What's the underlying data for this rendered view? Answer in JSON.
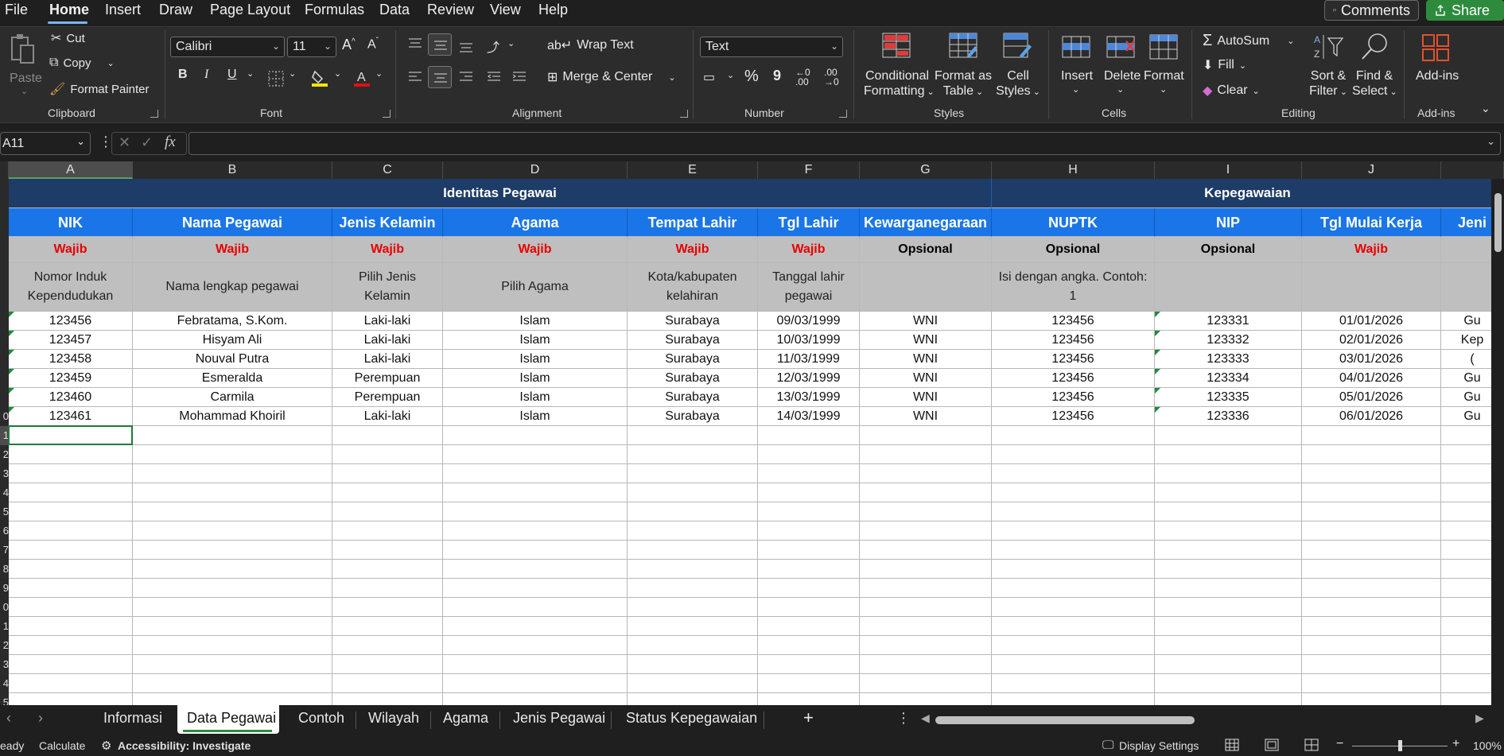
{
  "menu": {
    "tabs": [
      "File",
      "Home",
      "Insert",
      "Draw",
      "Page Layout",
      "Formulas",
      "Data",
      "Review",
      "View",
      "Help"
    ],
    "comments": "Comments",
    "share": "Share"
  },
  "ribbon": {
    "clipboard": {
      "paste": "Paste",
      "cut": "Cut",
      "copy": "Copy",
      "format_painter": "Format Painter",
      "label": "Clipboard"
    },
    "font": {
      "name": "Calibri",
      "size": "11",
      "bold": "B",
      "italic": "I",
      "underline": "U",
      "label": "Font"
    },
    "alignment": {
      "wrap_text": "Wrap Text",
      "merge_center": "Merge & Center",
      "label": "Alignment"
    },
    "number": {
      "format": "Text",
      "percent": "%",
      "comma": "9",
      "label": "Number"
    },
    "styles": {
      "conditional": [
        "Conditional",
        "Formatting"
      ],
      "format_table": [
        "Format as",
        "Table"
      ],
      "cell_styles": [
        "Cell",
        "Styles"
      ],
      "label": "Styles"
    },
    "cells": {
      "insert": "Insert",
      "delete": "Delete",
      "format": "Format",
      "label": "Cells"
    },
    "editing": {
      "autosum": "AutoSum",
      "fill": "Fill",
      "clear": "Clear",
      "sort_filter": [
        "Sort &",
        "Filter"
      ],
      "find_select": [
        "Find &",
        "Select"
      ],
      "label": "Editing"
    },
    "addins": {
      "addins": "Add-ins",
      "label": "Add-ins"
    }
  },
  "formula_bar": {
    "name_box": "A11",
    "fx": "fx",
    "content": ""
  },
  "grid": {
    "columns": [
      "A",
      "B",
      "C",
      "D",
      "E",
      "F",
      "G",
      "H",
      "I",
      "J",
      ""
    ],
    "selected_column": "A",
    "section_headers": [
      "Identitas Pegawai",
      "Kepegawaian"
    ],
    "field_headers": [
      "NIK",
      "Nama Pegawai",
      "Jenis Kelamin",
      "Agama",
      "Tempat Lahir",
      "Tgl Lahir",
      "Kewarganegaraan",
      "NUPTK",
      "NIP",
      "Tgl Mulai Kerja",
      "Jeni"
    ],
    "requirement": [
      "Wajib",
      "Wajib",
      "Wajib",
      "Wajib",
      "Wajib",
      "Wajib",
      "Opsional",
      "Opsional",
      "Opsional",
      "Wajib",
      ""
    ],
    "descriptions": [
      "Nomor Induk Kependudukan",
      "Nama lengkap pegawai",
      "Pilih Jenis Kelamin",
      "Pilih Agama",
      "Kota/kabupaten kelahiran",
      "Tanggal lahir pegawai",
      "",
      "Isi dengan angka. Contoh: 1",
      "",
      "",
      ""
    ],
    "rows": [
      [
        "123456",
        "Febratama, S.Kom.",
        "Laki-laki",
        "Islam",
        "Surabaya",
        "09/03/1999",
        "WNI",
        "123456",
        "123331",
        "01/01/2026",
        "Gu"
      ],
      [
        "123457",
        "Hisyam Ali",
        "Laki-laki",
        "Islam",
        "Surabaya",
        "10/03/1999",
        "WNI",
        "123456",
        "123332",
        "02/01/2026",
        "Kep"
      ],
      [
        "123458",
        "Nouval Putra",
        "Laki-laki",
        "Islam",
        "Surabaya",
        "11/03/1999",
        "WNI",
        "123456",
        "123333",
        "03/01/2026",
        "("
      ],
      [
        "123459",
        "Esmeralda",
        "Perempuan",
        "Islam",
        "Surabaya",
        "12/03/1999",
        "WNI",
        "123456",
        "123334",
        "04/01/2026",
        "Gu"
      ],
      [
        "123460",
        "Carmila",
        "Perempuan",
        "Islam",
        "Surabaya",
        "13/03/1999",
        "WNI",
        "123456",
        "123335",
        "05/01/2026",
        "Gu"
      ],
      [
        "123461",
        "Mohammad Khoiril",
        "Laki-laki",
        "Islam",
        "Surabaya",
        "14/03/1999",
        "WNI",
        "123456",
        "123336",
        "06/01/2026",
        "Gu"
      ]
    ],
    "row_numbers": [
      "",
      "",
      "",
      "",
      "",
      "",
      "",
      "",
      "",
      "0",
      "1",
      "2",
      "3",
      "4",
      "5",
      "6",
      "7",
      "8",
      "9",
      "0",
      "1",
      "2",
      "3",
      "4",
      "5"
    ]
  },
  "sheets": {
    "tabs": [
      "Informasi",
      "Data Pegawai",
      "Contoh",
      "Wilayah",
      "Agama",
      "Jenis Pegawai",
      "Status Kepegawaian"
    ],
    "active": "Data Pegawai",
    "add": "+"
  },
  "status": {
    "ready": "eady",
    "calculate": "Calculate",
    "accessibility": "Accessibility: Investigate",
    "display_settings": "Display Settings",
    "zoom": "100%"
  }
}
